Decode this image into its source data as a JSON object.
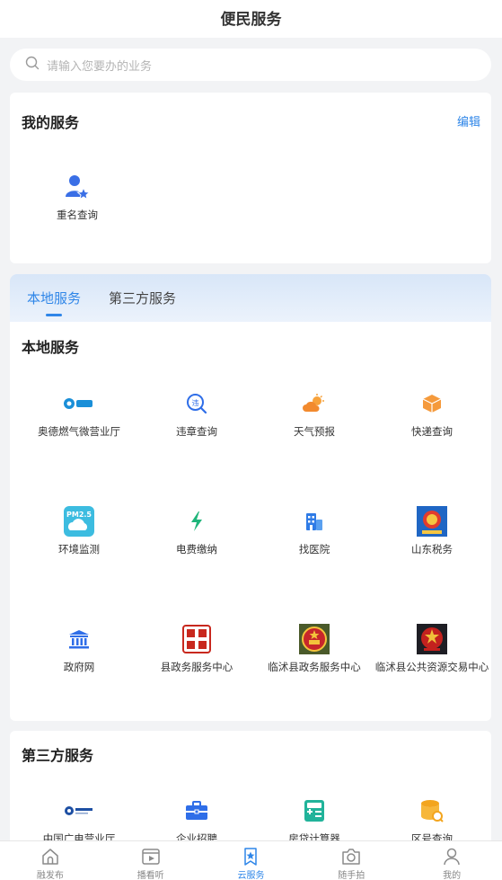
{
  "header": {
    "title": "便民服务"
  },
  "search": {
    "placeholder": "请输入您要办的业务"
  },
  "my_services": {
    "title": "我的服务",
    "edit_label": "编辑",
    "items": [
      {
        "label": "重名查询",
        "icon": "user-star-icon"
      }
    ]
  },
  "tabs": [
    {
      "label": "本地服务",
      "active": true
    },
    {
      "label": "第三方服务",
      "active": false
    }
  ],
  "local_services": {
    "title": "本地服务",
    "items": [
      {
        "label": "奥德燃气微营业厅",
        "icon": "aode-gas-logo"
      },
      {
        "label": "违章查询",
        "icon": "violation-search-icon"
      },
      {
        "label": "天气预报",
        "icon": "weather-icon"
      },
      {
        "label": "快递查询",
        "icon": "package-icon"
      },
      {
        "label": "环境监测",
        "icon": "pm25-icon"
      },
      {
        "label": "电费缴纳",
        "icon": "lightning-icon"
      },
      {
        "label": "找医院",
        "icon": "hospital-icon"
      },
      {
        "label": "山东税务",
        "icon": "tax-emblem-icon"
      },
      {
        "label": "政府网",
        "icon": "government-building-icon"
      },
      {
        "label": "县政务服务中心",
        "icon": "seal-icon"
      },
      {
        "label": "临沭县政务服务中心",
        "icon": "national-emblem-icon"
      },
      {
        "label": "临沭县公共资源交易中心",
        "icon": "party-emblem-icon"
      }
    ]
  },
  "third_party_services": {
    "title": "第三方服务",
    "items": [
      {
        "label": "中国广电营业厅",
        "icon": "china-broadnet-logo"
      },
      {
        "label": "企业招聘",
        "icon": "briefcase-icon"
      },
      {
        "label": "房贷计算器",
        "icon": "calculator-icon"
      },
      {
        "label": "区号查询",
        "icon": "database-search-icon"
      }
    ]
  },
  "bottom_nav": [
    {
      "label": "融发布",
      "icon": "home-icon",
      "active": false
    },
    {
      "label": "播看听",
      "icon": "video-icon",
      "active": false
    },
    {
      "label": "云服务",
      "icon": "bookmark-star-icon",
      "active": true
    },
    {
      "label": "随手拍",
      "icon": "camera-icon",
      "active": false
    },
    {
      "label": "我的",
      "icon": "user-icon",
      "active": false
    }
  ],
  "colors": {
    "accent": "#2f86e8",
    "background": "#f2f3f5"
  }
}
